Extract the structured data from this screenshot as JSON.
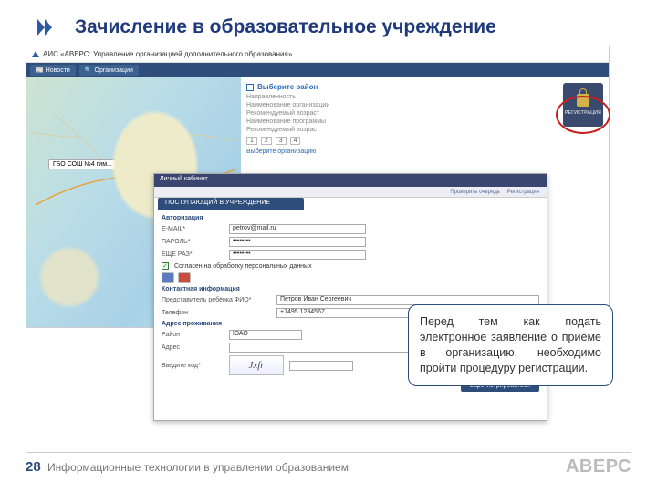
{
  "slide": {
    "title": "Зачисление в образовательное учреждение",
    "page_number": "28",
    "footer": "Информационные технологии в управлении образованием",
    "brand": "АВЕРС"
  },
  "callout": {
    "text": "Перед тем как подать электронное заявление о приёме в организацию, необходимо пройти процедуру регистрации."
  },
  "back_app": {
    "title": "АИС «АВЕРС: Управление организацией дополнительного образования»",
    "toolbar": {
      "btn1": "Новости",
      "btn2": "Организации"
    },
    "map_pin": "ГБО СОШ №4 гим...",
    "panel_head": "Выберите район",
    "filter_lines": [
      "Направленность",
      "Наименование организации",
      "Рекомендуемый возраст",
      "Наименование программы",
      "Рекомендуемый возраст"
    ],
    "nums": [
      "1",
      "2",
      "3",
      "4"
    ],
    "selector": "Выберите организацию",
    "reg_label": "РЕГИСТРАЦИЯ"
  },
  "form": {
    "win_title": "Личный кабинет",
    "links": {
      "a": "Проверить очередь",
      "b": "Регистрация"
    },
    "tab": "ПОСТУПАЮЩИЙ В УЧРЕЖДЕНИЕ",
    "sec1": "Авторизация",
    "fields": {
      "email_lbl": "E-MAIL*",
      "email_val": "petrov@mail.ru",
      "pass_lbl": "ПАРОЛЬ*",
      "pass_val": "••••••••",
      "pass2_lbl": "ЕЩЁ РАЗ*",
      "pass2_val": "••••••••"
    },
    "consent": "Согласен на обработку персональных данных",
    "sec2": "Контактная информация",
    "fields2": {
      "fio_lbl": "Представитель ребёнка ФИО*",
      "fio_val": "Петров Иван Сергеевич",
      "phone_lbl": "Телефон",
      "phone_val": "+7495 1234567"
    },
    "sec3": "Адрес проживания",
    "fields3": {
      "reg_lbl": "Район",
      "reg_val": "ЮАО",
      "addr_lbl": "Адрес",
      "addr_val": ""
    },
    "captcha_lbl": "Введите код*",
    "captcha_img": "Jxfr",
    "submit": "Зарегистрироваться"
  }
}
